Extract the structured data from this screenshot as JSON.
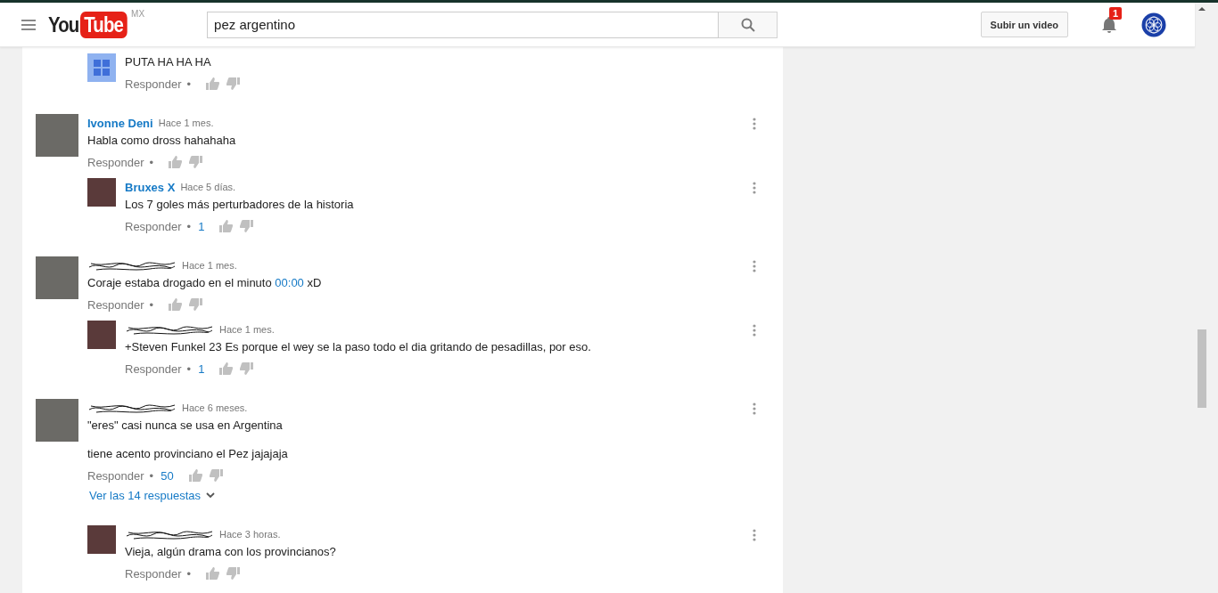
{
  "header": {
    "logo_left": "You",
    "logo_right": "Tube",
    "region": "MX",
    "search": {
      "value": "pez argentino"
    },
    "upload_button": "Subir un video",
    "notifications": "1"
  },
  "threads": [
    {
      "replies": [
        {
          "kind": "default_avatar",
          "paragraphs": [
            [
              {
                "kind": "plain",
                "text": "PUTA HA HA HA"
              }
            ]
          ],
          "reply_label": "Responder",
          "separator": "•"
        }
      ]
    },
    {
      "comment": {
        "kind": "photo_avatar",
        "author": "Ivonne Deni",
        "time": "Hace 1 mes.",
        "paragraphs": [
          [
            {
              "kind": "plain",
              "text": "Habla como dross hahahaha"
            }
          ]
        ],
        "reply_label": "Responder",
        "separator": "•"
      },
      "replies": [
        {
          "kind": "photo_avatar",
          "author": "Bruxes X",
          "time": "Hace 5 días.",
          "paragraphs": [
            [
              {
                "kind": "plain",
                "text": "Los 7 goles más perturbadores de la historia"
              }
            ]
          ],
          "reply_label": "Responder",
          "separator": "•",
          "likes": "1"
        }
      ]
    },
    {
      "comment": {
        "kind": "photo_avatar",
        "author_redacted": true,
        "time": "Hace 1 mes.",
        "paragraphs": [
          [
            {
              "kind": "plain",
              "text": "Coraje estaba drogado en el minuto "
            },
            {
              "kind": "link",
              "text": "00:00"
            },
            {
              "kind": "plain",
              "text": " xD"
            }
          ]
        ],
        "reply_label": "Responder",
        "separator": "•"
      },
      "replies": [
        {
          "kind": "photo_avatar",
          "author_redacted": true,
          "time": "Hace 1 mes.",
          "paragraphs": [
            [
              {
                "kind": "plain",
                "text": "+Steven Funkel 23 Es porque el wey se la paso todo el dia gritando de pesadillas, por eso."
              }
            ]
          ],
          "reply_label": "Responder",
          "separator": "•",
          "likes": "1"
        }
      ]
    },
    {
      "comment": {
        "kind": "photo_avatar",
        "author_redacted": true,
        "time": "Hace 6 meses.",
        "paragraphs": [
          [
            {
              "kind": "plain",
              "text": "\"eres\" casi nunca se usa en Argentina"
            }
          ],
          [
            {
              "kind": "plain",
              "text": "tiene acento provinciano el Pez jajajaja"
            }
          ]
        ],
        "reply_label": "Responder",
        "separator": "•",
        "likes": "50"
      },
      "view_replies": "Ver las 14 respuestas",
      "replies": [
        {
          "kind": "photo_avatar",
          "author_redacted": true,
          "time": "Hace 3 horas.",
          "paragraphs": [
            [
              {
                "kind": "plain",
                "text": "Vieja, algún drama con los provincianos?"
              }
            ]
          ],
          "reply_label": "Responder",
          "separator": "•"
        }
      ]
    }
  ]
}
